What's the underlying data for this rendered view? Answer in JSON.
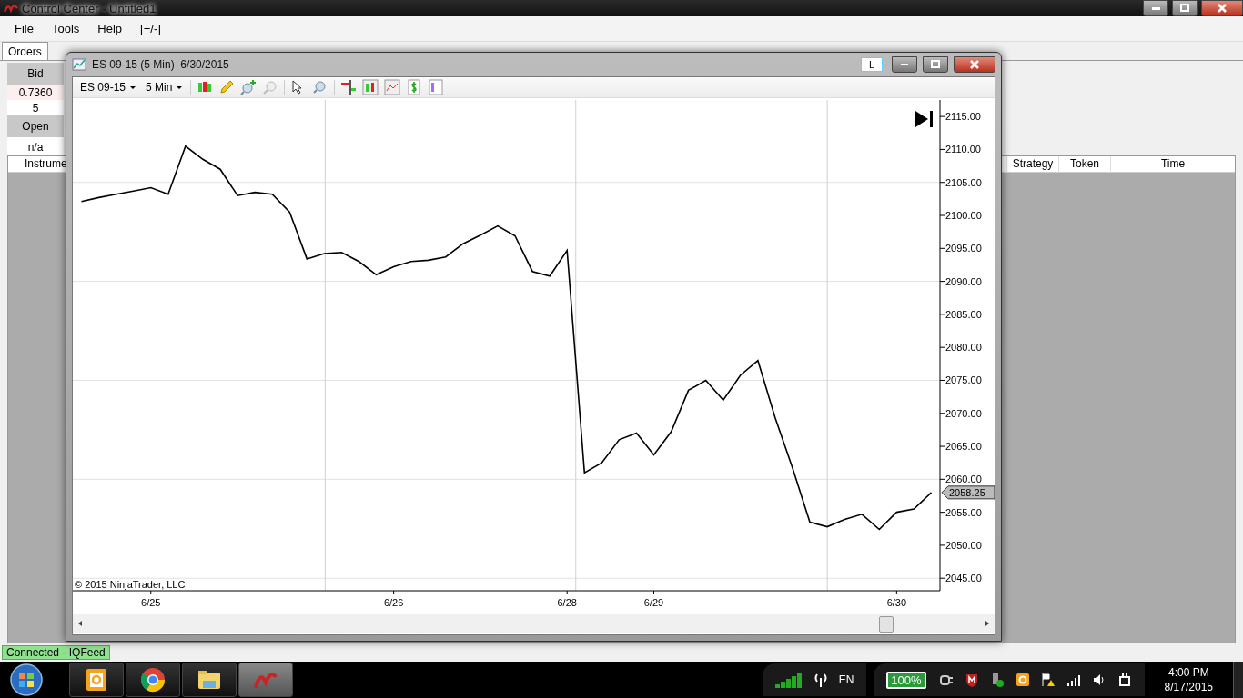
{
  "control_center": {
    "title": "Control Center - Untitled1",
    "menu": [
      "File",
      "Tools",
      "Help",
      "[+/-]"
    ],
    "tabs": [
      {
        "label": "Orders",
        "selected": true
      }
    ],
    "quote": {
      "bid_label": "Bid",
      "bid": "0.7360",
      "bid_size": "5",
      "open_label": "Open",
      "open": "n/a"
    },
    "grid_columns": [
      "Instrume",
      "Strategy",
      "Token",
      "Time"
    ],
    "status": "Connected - IQFeed"
  },
  "chart_window": {
    "title": "ES 09-15 (5 Min)  6/30/2015",
    "link_button": "L",
    "instrument": "ES 09-15",
    "interval": "5 Min",
    "copyright": "© 2015 NinjaTrader, LLC",
    "last_price": "2058.25",
    "chart_data": {
      "type": "line",
      "categories": [
        null,
        null,
        null,
        null,
        "6/25",
        null,
        null,
        null,
        null,
        null,
        null,
        null,
        null,
        null,
        null,
        null,
        null,
        null,
        "6/26",
        null,
        null,
        null,
        null,
        null,
        null,
        null,
        null,
        null,
        "6/28",
        null,
        null,
        null,
        null,
        "6/29",
        null,
        null,
        null,
        null,
        null,
        null,
        null,
        null,
        null,
        null,
        null,
        null,
        null,
        "6/30",
        null,
        null
      ],
      "series": [
        {
          "color": "#000000",
          "values": [
            2102.1,
            2102.7,
            2103.2,
            2103.7,
            2104.2,
            2103.2,
            2110.5,
            2108.5,
            2107,
            2103,
            2103.5,
            2103.2,
            2100.5,
            2093.4,
            2094.2,
            2094.4,
            2093,
            2091,
            2092.2,
            2093,
            2093.2,
            2093.7,
            2095.7,
            2097,
            2098.4,
            2096.9,
            2091.5,
            2090.8,
            2094.7,
            2061,
            2062.5,
            2066,
            2067,
            2063.7,
            2067.2,
            2073.5,
            2075,
            2072,
            2075.8,
            2078,
            2069.3,
            2061.7,
            2053.5,
            2052.8,
            2053.9,
            2054.7,
            2052.4,
            2055,
            2055.5,
            2058
          ]
        }
      ],
      "ylim": [
        2043.1,
        2117.5
      ],
      "grid": true,
      "yticks": [
        {
          "value": 2045,
          "label": "2045.00"
        },
        {
          "value": 2050,
          "label": "2050.00"
        },
        {
          "value": 2055,
          "label": "2055.00"
        },
        {
          "value": 2060,
          "label": "2060.00"
        },
        {
          "value": 2065,
          "label": "2065.00"
        },
        {
          "value": 2070,
          "label": "2070.00"
        },
        {
          "value": 2075,
          "label": "2075.00"
        },
        {
          "value": 2080,
          "label": "2080.00"
        },
        {
          "value": 2085,
          "label": "2085.00"
        },
        {
          "value": 2090,
          "label": "2090.00"
        },
        {
          "value": 2095,
          "label": "2095.00"
        },
        {
          "value": 2100,
          "label": "2100.00"
        },
        {
          "value": 2105,
          "label": "2105.00"
        },
        {
          "value": 2110,
          "label": "2110.00"
        },
        {
          "value": 2115,
          "label": "2115.00"
        }
      ]
    }
  },
  "taskbar": {
    "language": "EN",
    "battery": "100%",
    "time": "4:00 PM",
    "date": "8/17/2015"
  }
}
